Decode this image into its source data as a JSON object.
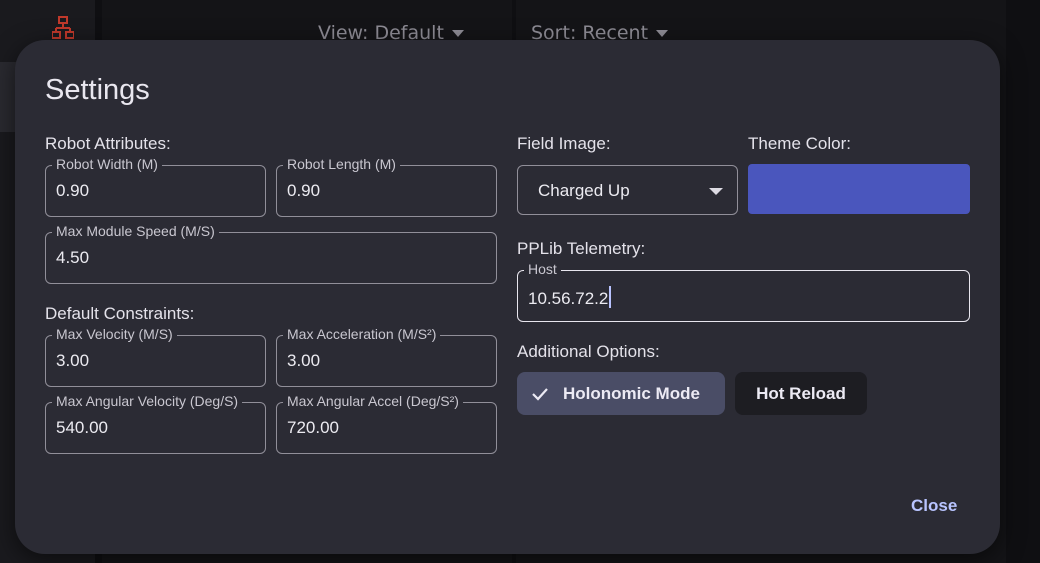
{
  "background": {
    "view_dropdown": "View: Default",
    "sort_dropdown": "Sort: Recent",
    "rail_icon": "sitemap-icon"
  },
  "dialog": {
    "title": "Settings",
    "robot_attributes": {
      "label": "Robot Attributes:",
      "width": {
        "label": "Robot Width (M)",
        "value": "0.90"
      },
      "length": {
        "label": "Robot Length (M)",
        "value": "0.90"
      },
      "max_module_speed": {
        "label": "Max Module Speed (M/S)",
        "value": "4.50"
      }
    },
    "default_constraints": {
      "label": "Default Constraints:",
      "max_velocity": {
        "label": "Max Velocity (M/S)",
        "value": "3.00"
      },
      "max_acceleration": {
        "label": "Max Acceleration (M/S²)",
        "value": "3.00"
      },
      "max_angular_velocity": {
        "label": "Max Angular Velocity (Deg/S)",
        "value": "540.00"
      },
      "max_angular_accel": {
        "label": "Max Angular Accel (Deg/S²)",
        "value": "720.00"
      }
    },
    "field_image": {
      "label": "Field Image:",
      "selected": "Charged Up"
    },
    "theme_color": {
      "label": "Theme Color:",
      "color": "#4a56bd"
    },
    "telemetry": {
      "label": "PPLib Telemetry:",
      "host": {
        "label": "Host",
        "value": "10.56.72.2"
      }
    },
    "additional_options": {
      "label": "Additional Options:",
      "holonomic": {
        "label": "Holonomic Mode",
        "selected": true
      },
      "hot_reload": {
        "label": "Hot Reload",
        "selected": false
      }
    },
    "close_label": "Close"
  },
  "colors": {
    "dialog_bg": "#2b2b34",
    "accent": "#b8c4ff",
    "theme_swatch": "#4a56bd",
    "chip_selected": "#4a4d66"
  }
}
